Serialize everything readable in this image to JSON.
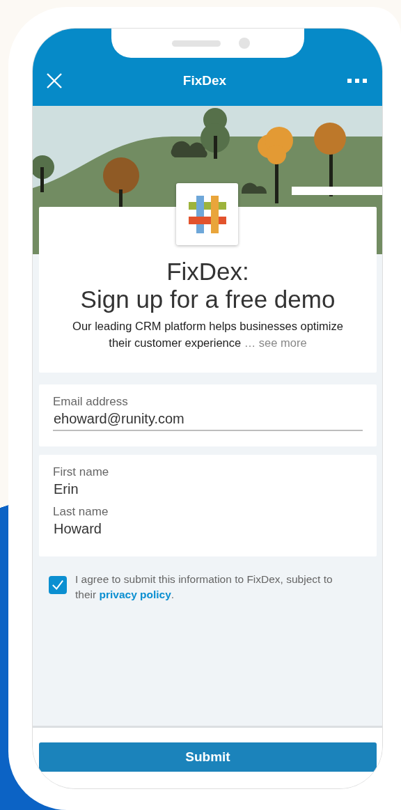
{
  "header": {
    "title": "FixDex"
  },
  "intro": {
    "title_line_1": "FixDex:",
    "title_line_2": "Sign up for a free demo",
    "description": "Our leading CRM platform helps businesses optimize their customer experience",
    "more_link": "… see more"
  },
  "field_groups": [
    {
      "fields": [
        {
          "kind": "underlined",
          "label": "Email address",
          "value": "ehoward@runity.com"
        }
      ]
    },
    {
      "fields": [
        {
          "kind": "plain",
          "label": "First name",
          "value": "Erin"
        },
        {
          "kind": "plain",
          "label": "Last name",
          "value": "Howard"
        }
      ]
    }
  ],
  "consent": {
    "checked": true,
    "text_before": "I agree to submit this information to FixDex, subject to their ",
    "link": "privacy policy",
    "text_after": "."
  },
  "submit": {
    "label": "Submit"
  }
}
